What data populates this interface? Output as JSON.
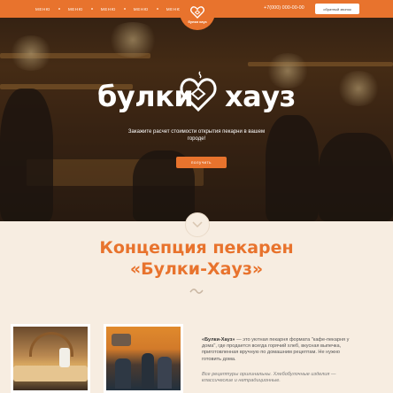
{
  "nav": {
    "items": [
      "меню",
      "меню",
      "меню",
      "меню",
      "меню"
    ]
  },
  "header": {
    "logo_text": "булки хауз",
    "phone": "+7(000) 000-00-00",
    "callback_label": "обратный звонок"
  },
  "hero": {
    "brand_left": "булки",
    "brand_right": "хауз",
    "subtitle": "Закажите расчет стоимости открытия пекарни в вашем городе!",
    "button_label": "получить"
  },
  "concept": {
    "title_line1": "Концепция пекарен",
    "title_line2": "«Булки-Хауз»",
    "intro_brand": "«Булки-Хауз»",
    "intro_text": " — это уютная пекарня формата \"кафе-пекарня у дома\", где продается всегда горячий хлеб, вкусная выпечка, приготовленная вручную по домашним рецептам. Не нужно готовить дома.",
    "note": "Все рецептуры оригинальны. Хлебобулочные изделия — классические и нетрадиционные."
  },
  "colors": {
    "accent": "#e8732d",
    "background": "#f7ede1"
  },
  "icons": [
    "heart-logo-icon",
    "chevron-down-icon",
    "wave-divider-icon"
  ]
}
